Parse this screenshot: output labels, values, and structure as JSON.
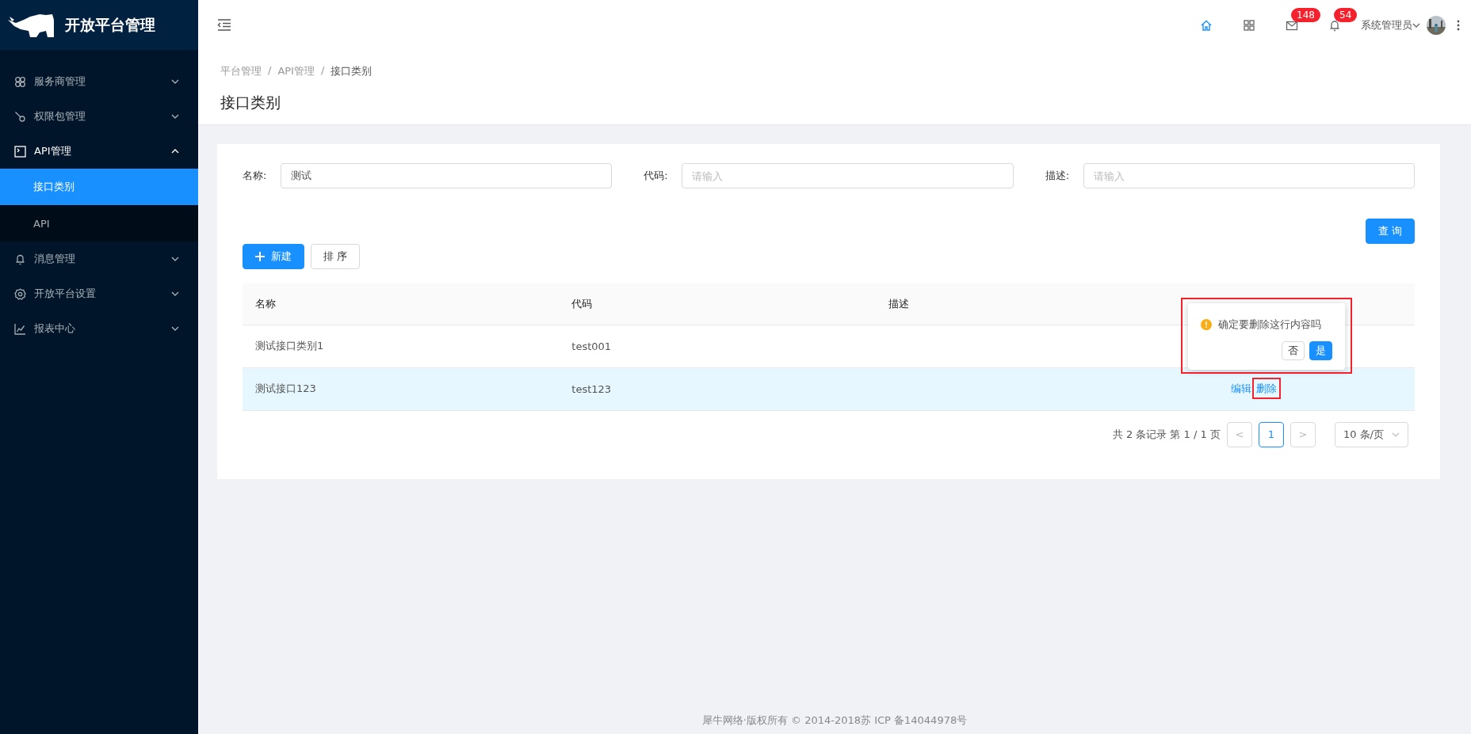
{
  "sidebar": {
    "title": "开放平台管理",
    "items": [
      {
        "label": "服务商管理",
        "expanded": false
      },
      {
        "label": "权限包管理",
        "expanded": false
      },
      {
        "label": "API管理",
        "expanded": true,
        "children": [
          {
            "label": "接口类别",
            "selected": true
          },
          {
            "label": "API",
            "selected": false
          }
        ]
      },
      {
        "label": "消息管理",
        "expanded": false
      },
      {
        "label": "开放平台设置",
        "expanded": false
      },
      {
        "label": "报表中心",
        "expanded": false
      }
    ]
  },
  "header": {
    "icons": [
      {
        "kind": "home",
        "active": true
      },
      {
        "kind": "apps",
        "active": false
      },
      {
        "kind": "mail",
        "active": false,
        "badge": "148"
      },
      {
        "kind": "bell",
        "active": false,
        "badge": "54"
      }
    ],
    "user": "系统管理员"
  },
  "breadcrumb": [
    {
      "label": "平台管理",
      "separator": "/"
    },
    {
      "label": "API管理",
      "separator": "/"
    },
    {
      "label": "接口类别"
    }
  ],
  "page_title": "接口类别",
  "filters": [
    {
      "label": "名称:",
      "value": "测试"
    },
    {
      "label": "代码:",
      "placeholder": "请输入"
    },
    {
      "label": "描述:",
      "placeholder": "请输入"
    }
  ],
  "query_button": "查 询",
  "buttons": [
    {
      "kind": "primary",
      "label": "新建"
    },
    {
      "kind": "default",
      "label": "排 序"
    }
  ],
  "table": {
    "columns": [
      "名称",
      "代码",
      "描述"
    ],
    "rows": [
      {
        "cells": [
          "测试接口类别1",
          "test001"
        ],
        "highlighted": false
      },
      {
        "cells": [
          "测试接口123",
          "test123"
        ],
        "highlighted": true,
        "actions": [
          "编辑",
          "删除"
        ]
      }
    ]
  },
  "popover": {
    "message": "确定要删除这行内容吗",
    "buttons": [
      {
        "label": "否",
        "primary": false
      },
      {
        "label": "是",
        "primary": true
      }
    ]
  },
  "pagination": {
    "summary": "共 2 条记录 第 1 / 1 页",
    "prev": "<",
    "next": ">",
    "pages": [
      {
        "label": "1",
        "selected": true
      }
    ],
    "page_size": "10 条/页"
  },
  "footer": "犀牛网络·版权所有 © 2014-2018苏 ICP 备14044978号"
}
